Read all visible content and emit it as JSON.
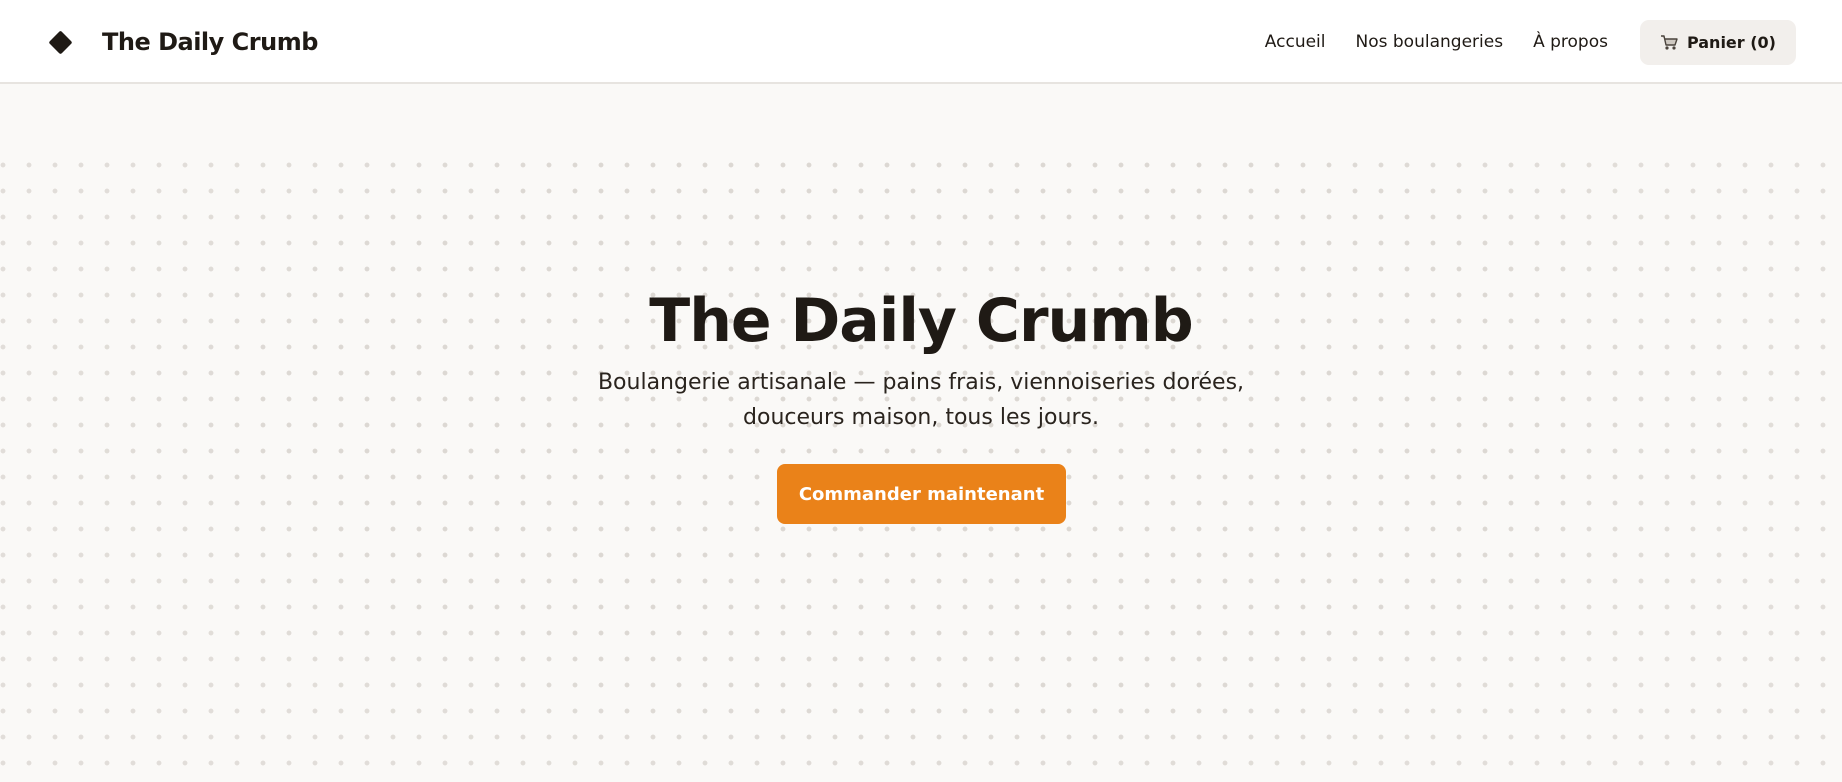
{
  "header": {
    "brand_name": "The Daily Crumb",
    "brand_icon": "diamond-logo-icon",
    "nav": [
      {
        "label": "Accueil"
      },
      {
        "label": "Nos boulangeries"
      },
      {
        "label": "À propos"
      }
    ],
    "cart": {
      "icon": "cart-icon",
      "label": "Panier (0)"
    }
  },
  "hero": {
    "title": "The Daily Crumb",
    "subtitle": "Boulangerie artisanale — pains frais, viennoiseries dorées, douceurs maison, tous les jours.",
    "cta_label": "Commander maintenant"
  },
  "colors": {
    "accent": "#ea8219",
    "text": "#1f1a15",
    "background": "#faf9f7",
    "cart_bg": "#f2efec"
  }
}
